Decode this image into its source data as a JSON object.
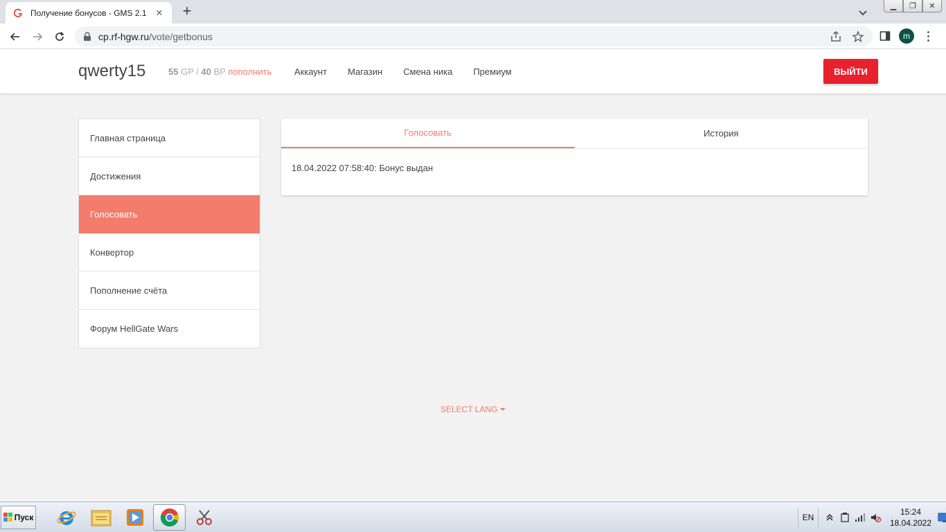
{
  "browser": {
    "tab_title": "Получение бонусов - GMS 2.1",
    "url_host": "cp.rf-hgw.ru",
    "url_path": "/vote/getbonus",
    "profile_initial": "m"
  },
  "header": {
    "username": "qwerty15",
    "gp_value": "55",
    "gp_unit": "GP",
    "separator": "/",
    "bp_value": "40",
    "bp_unit": "BP",
    "topup_label": "пополнить",
    "nav": [
      "Аккаунт",
      "Магазин",
      "Смена ника",
      "Премиум"
    ],
    "logout_label": "ВЫЙТИ"
  },
  "sidebar": {
    "items": [
      "Главная страница",
      "Достижения",
      "Голосовать",
      "Конвертор",
      "Пополнение счёта",
      "Форум HellGate Wars"
    ],
    "active_index": 2
  },
  "content": {
    "tabs": [
      "Голосовать",
      "История"
    ],
    "active_tab": 0,
    "message": "18.04.2022 07:58:40: Бонус выдан"
  },
  "footer": {
    "select_lang": "SELECT LANG"
  },
  "taskbar": {
    "start_label": "Пуск",
    "lang": "EN",
    "time": "15:24",
    "date": "18.04.2022"
  },
  "colors": {
    "accent": "#f47c6c",
    "logout": "#e8212d"
  }
}
